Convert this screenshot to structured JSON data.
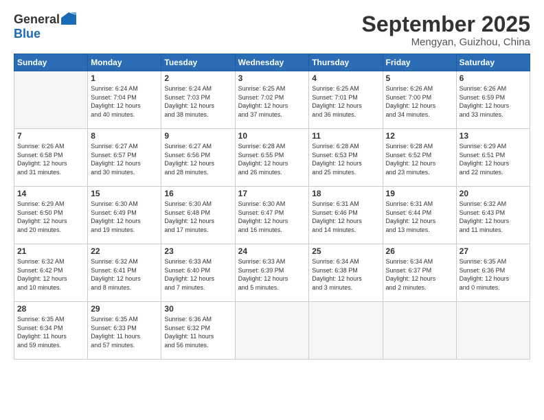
{
  "logo": {
    "general": "General",
    "blue": "Blue"
  },
  "title": "September 2025",
  "location": "Mengyan, Guizhou, China",
  "days_of_week": [
    "Sunday",
    "Monday",
    "Tuesday",
    "Wednesday",
    "Thursday",
    "Friday",
    "Saturday"
  ],
  "weeks": [
    [
      {
        "day": "",
        "info": ""
      },
      {
        "day": "1",
        "info": "Sunrise: 6:24 AM\nSunset: 7:04 PM\nDaylight: 12 hours\nand 40 minutes."
      },
      {
        "day": "2",
        "info": "Sunrise: 6:24 AM\nSunset: 7:03 PM\nDaylight: 12 hours\nand 38 minutes."
      },
      {
        "day": "3",
        "info": "Sunrise: 6:25 AM\nSunset: 7:02 PM\nDaylight: 12 hours\nand 37 minutes."
      },
      {
        "day": "4",
        "info": "Sunrise: 6:25 AM\nSunset: 7:01 PM\nDaylight: 12 hours\nand 36 minutes."
      },
      {
        "day": "5",
        "info": "Sunrise: 6:26 AM\nSunset: 7:00 PM\nDaylight: 12 hours\nand 34 minutes."
      },
      {
        "day": "6",
        "info": "Sunrise: 6:26 AM\nSunset: 6:59 PM\nDaylight: 12 hours\nand 33 minutes."
      }
    ],
    [
      {
        "day": "7",
        "info": "Sunrise: 6:26 AM\nSunset: 6:58 PM\nDaylight: 12 hours\nand 31 minutes."
      },
      {
        "day": "8",
        "info": "Sunrise: 6:27 AM\nSunset: 6:57 PM\nDaylight: 12 hours\nand 30 minutes."
      },
      {
        "day": "9",
        "info": "Sunrise: 6:27 AM\nSunset: 6:56 PM\nDaylight: 12 hours\nand 28 minutes."
      },
      {
        "day": "10",
        "info": "Sunrise: 6:28 AM\nSunset: 6:55 PM\nDaylight: 12 hours\nand 26 minutes."
      },
      {
        "day": "11",
        "info": "Sunrise: 6:28 AM\nSunset: 6:53 PM\nDaylight: 12 hours\nand 25 minutes."
      },
      {
        "day": "12",
        "info": "Sunrise: 6:28 AM\nSunset: 6:52 PM\nDaylight: 12 hours\nand 23 minutes."
      },
      {
        "day": "13",
        "info": "Sunrise: 6:29 AM\nSunset: 6:51 PM\nDaylight: 12 hours\nand 22 minutes."
      }
    ],
    [
      {
        "day": "14",
        "info": "Sunrise: 6:29 AM\nSunset: 6:50 PM\nDaylight: 12 hours\nand 20 minutes."
      },
      {
        "day": "15",
        "info": "Sunrise: 6:30 AM\nSunset: 6:49 PM\nDaylight: 12 hours\nand 19 minutes."
      },
      {
        "day": "16",
        "info": "Sunrise: 6:30 AM\nSunset: 6:48 PM\nDaylight: 12 hours\nand 17 minutes."
      },
      {
        "day": "17",
        "info": "Sunrise: 6:30 AM\nSunset: 6:47 PM\nDaylight: 12 hours\nand 16 minutes."
      },
      {
        "day": "18",
        "info": "Sunrise: 6:31 AM\nSunset: 6:46 PM\nDaylight: 12 hours\nand 14 minutes."
      },
      {
        "day": "19",
        "info": "Sunrise: 6:31 AM\nSunset: 6:44 PM\nDaylight: 12 hours\nand 13 minutes."
      },
      {
        "day": "20",
        "info": "Sunrise: 6:32 AM\nSunset: 6:43 PM\nDaylight: 12 hours\nand 11 minutes."
      }
    ],
    [
      {
        "day": "21",
        "info": "Sunrise: 6:32 AM\nSunset: 6:42 PM\nDaylight: 12 hours\nand 10 minutes."
      },
      {
        "day": "22",
        "info": "Sunrise: 6:32 AM\nSunset: 6:41 PM\nDaylight: 12 hours\nand 8 minutes."
      },
      {
        "day": "23",
        "info": "Sunrise: 6:33 AM\nSunset: 6:40 PM\nDaylight: 12 hours\nand 7 minutes."
      },
      {
        "day": "24",
        "info": "Sunrise: 6:33 AM\nSunset: 6:39 PM\nDaylight: 12 hours\nand 5 minutes."
      },
      {
        "day": "25",
        "info": "Sunrise: 6:34 AM\nSunset: 6:38 PM\nDaylight: 12 hours\nand 3 minutes."
      },
      {
        "day": "26",
        "info": "Sunrise: 6:34 AM\nSunset: 6:37 PM\nDaylight: 12 hours\nand 2 minutes."
      },
      {
        "day": "27",
        "info": "Sunrise: 6:35 AM\nSunset: 6:36 PM\nDaylight: 12 hours\nand 0 minutes."
      }
    ],
    [
      {
        "day": "28",
        "info": "Sunrise: 6:35 AM\nSunset: 6:34 PM\nDaylight: 11 hours\nand 59 minutes."
      },
      {
        "day": "29",
        "info": "Sunrise: 6:35 AM\nSunset: 6:33 PM\nDaylight: 11 hours\nand 57 minutes."
      },
      {
        "day": "30",
        "info": "Sunrise: 6:36 AM\nSunset: 6:32 PM\nDaylight: 11 hours\nand 56 minutes."
      },
      {
        "day": "",
        "info": ""
      },
      {
        "day": "",
        "info": ""
      },
      {
        "day": "",
        "info": ""
      },
      {
        "day": "",
        "info": ""
      }
    ]
  ]
}
